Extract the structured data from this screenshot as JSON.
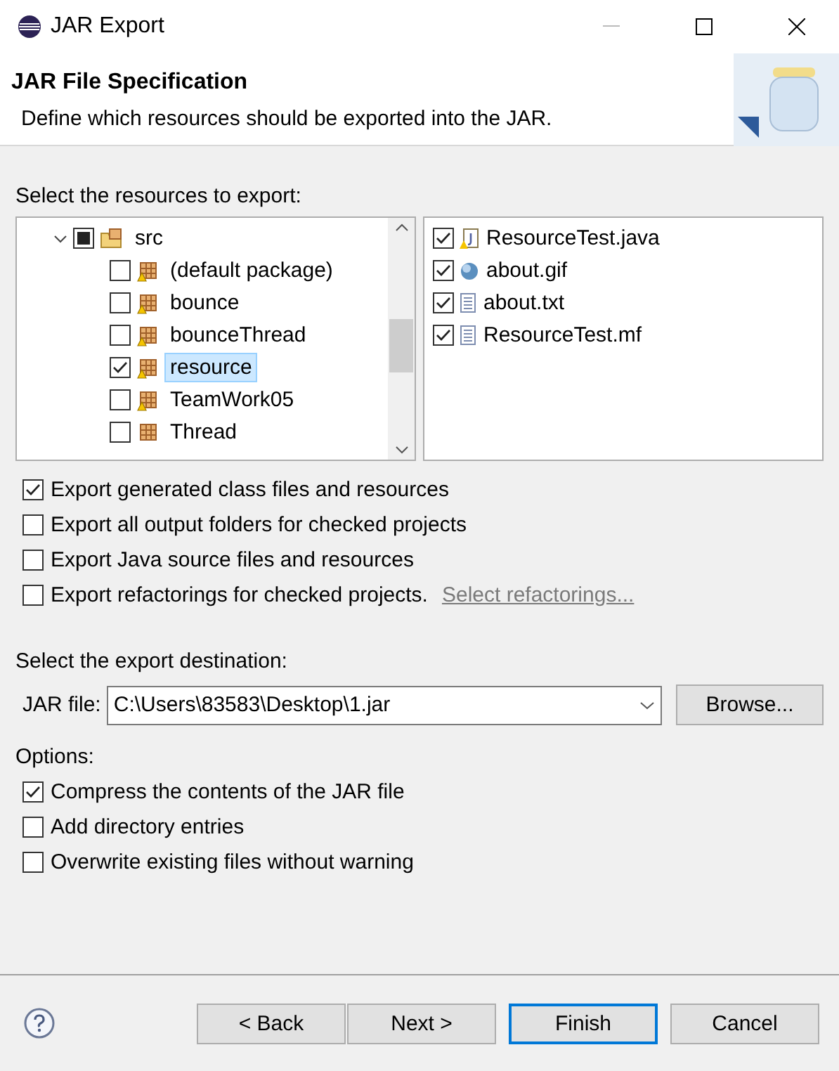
{
  "window": {
    "title": "JAR Export"
  },
  "header": {
    "title": "JAR File Specification",
    "description": "Define which resources should be exported into the JAR."
  },
  "resources": {
    "label": "Select the resources to export:",
    "tree": [
      {
        "label": "src",
        "mixed": true,
        "expanded": true,
        "selected": false,
        "children": [
          {
            "label": "(default package)",
            "checked": false,
            "selected": false,
            "kind": "package"
          },
          {
            "label": "bounce",
            "checked": false,
            "selected": false,
            "kind": "package"
          },
          {
            "label": "bounceThread",
            "checked": false,
            "selected": false,
            "kind": "package"
          },
          {
            "label": "resource",
            "checked": true,
            "selected": true,
            "kind": "package"
          },
          {
            "label": "TeamWork05",
            "checked": false,
            "selected": false,
            "kind": "package"
          },
          {
            "label": "Thread",
            "checked": false,
            "selected": false,
            "kind": "empty-package"
          }
        ]
      }
    ],
    "files": [
      {
        "label": "ResourceTest.java",
        "checked": true,
        "kind": "java"
      },
      {
        "label": "about.gif",
        "checked": true,
        "kind": "image"
      },
      {
        "label": "about.txt",
        "checked": true,
        "kind": "text"
      },
      {
        "label": "ResourceTest.mf",
        "checked": true,
        "kind": "text"
      }
    ]
  },
  "export_options": [
    {
      "label": "Export generated class files and resources",
      "checked": true
    },
    {
      "label": "Export all output folders for checked projects",
      "checked": false
    },
    {
      "label": "Export Java source files and resources",
      "checked": false
    },
    {
      "label": "Export refactorings for checked projects.",
      "checked": false,
      "link": "Select refactorings..."
    }
  ],
  "destination": {
    "label": "Select the export destination:",
    "field_label": "JAR file:",
    "value": "C:\\Users\\83583\\Desktop\\1.jar",
    "browse": "Browse..."
  },
  "options": {
    "label": "Options:",
    "items": [
      {
        "label": "Compress the contents of the JAR file",
        "checked": true
      },
      {
        "label": "Add directory entries",
        "checked": false
      },
      {
        "label": "Overwrite existing files without warning",
        "checked": false
      }
    ]
  },
  "buttons": [
    {
      "label": "< Back",
      "default": false
    },
    {
      "label": "Next >",
      "default": false
    },
    {
      "label": "Finish",
      "default": true
    },
    {
      "label": "Cancel",
      "default": false
    }
  ]
}
